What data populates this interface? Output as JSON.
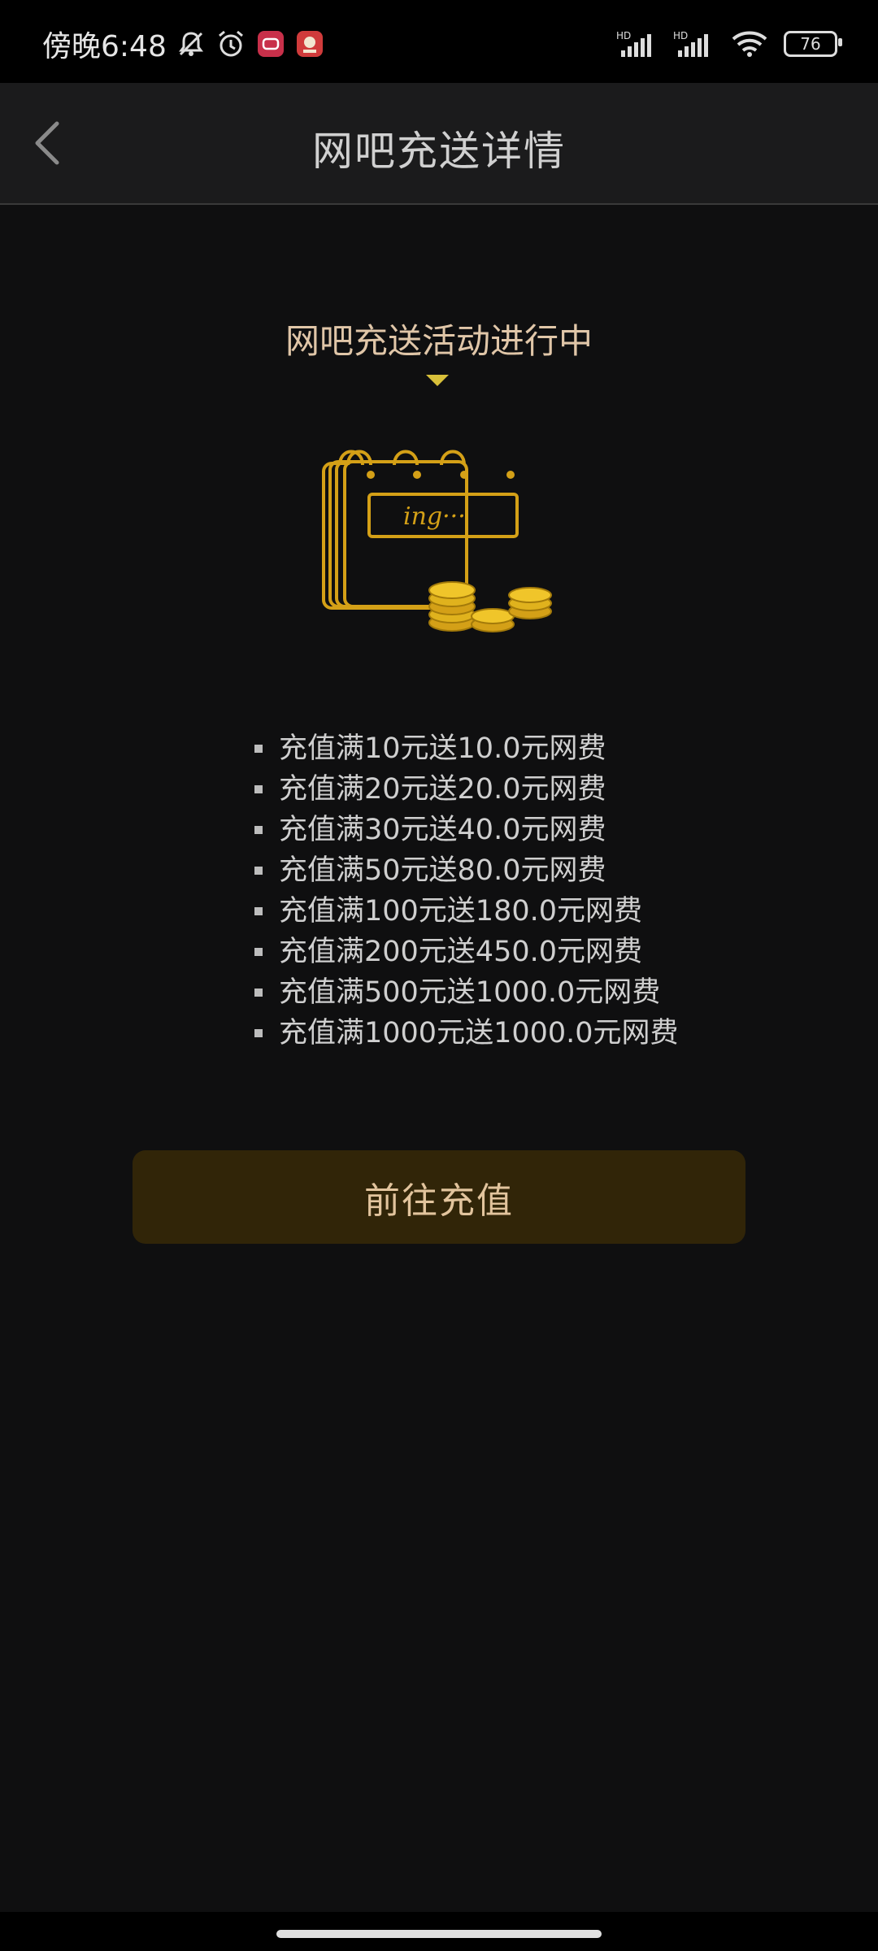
{
  "status_bar": {
    "time": "傍晚6:48",
    "battery": "76",
    "icons": [
      "bell-off-icon",
      "alarm-icon",
      "app-notification-icon",
      "app-notification-icon",
      "signal-hd-icon",
      "signal-hd-icon",
      "wifi-icon",
      "battery-icon"
    ],
    "signal_label_1": "HD",
    "signal_label_2": "HD"
  },
  "header": {
    "title": "网吧充送详情",
    "back_icon": "chevron-left-icon"
  },
  "promo": {
    "heading": "网吧充送活动进行中",
    "illustration_text": "ing···",
    "offers": [
      "充值满10元送10.0元网费",
      "充值满20元送20.0元网费",
      "充值满30元送40.0元网费",
      "充值满50元送80.0元网费",
      "充值满100元送180.0元网费",
      "充值满200元送450.0元网费",
      "充值满500元送1000.0元网费",
      "充值满1000元送1000.0元网费"
    ]
  },
  "cta": {
    "label": "前往充值"
  },
  "colors": {
    "accent_gold": "#d4a017",
    "heading_text": "#e0c6a8",
    "button_bg": "#312508",
    "background": "#0f0f10"
  }
}
